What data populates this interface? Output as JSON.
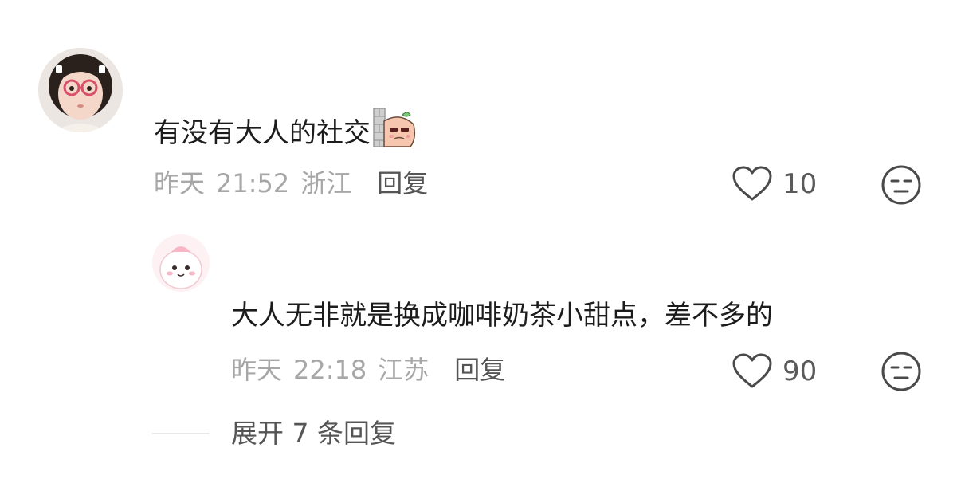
{
  "comments": [
    {
      "text": "有没有大人的社交",
      "sticker_icon": "peeking-sticker-icon",
      "date": "昨天",
      "time": "21:52",
      "location": "浙江",
      "reply_label": "回复",
      "likes": "10"
    },
    {
      "text": "大人无非就是换成咖啡奶茶小甜点，差不多的",
      "date": "昨天",
      "time": "22:18",
      "location": "江苏",
      "reply_label": "回复",
      "likes": "90"
    }
  ],
  "expand_replies_label": "展开 7 条回复",
  "icons": {
    "like": "heart-outline-icon",
    "dislike": "unamused-face-icon"
  },
  "colors": {
    "text_primary": "#1c1c1c",
    "text_meta": "#a7a7a7",
    "text_action": "#555555",
    "icon_stroke": "#4a4a4a"
  }
}
